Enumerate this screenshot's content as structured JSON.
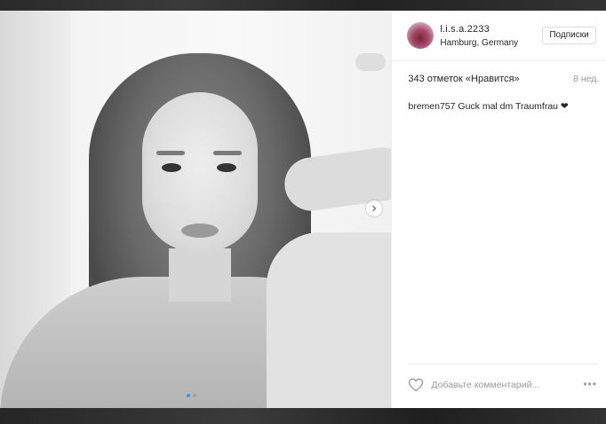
{
  "post": {
    "username": "l.i.s.a.2233",
    "location": "Hamburg, Germany",
    "follow_label": "Подписки",
    "likes_text": "343 отметок «Нравится»",
    "time_ago": "8 нед.",
    "comment": {
      "author": "bremen757",
      "text": "Guck mal dm Traumfrau ❤"
    },
    "comment_placeholder": "Добавьте комментарий...",
    "more_label": "•••",
    "carousel": {
      "total": 2,
      "active": 1
    }
  },
  "colors": {
    "accent": "#3897f0",
    "text": "#262626",
    "muted": "#999999",
    "border": "#dbdbdb"
  },
  "icons": [
    "chevron-right-icon",
    "heart-outline-icon",
    "more-icon"
  ]
}
